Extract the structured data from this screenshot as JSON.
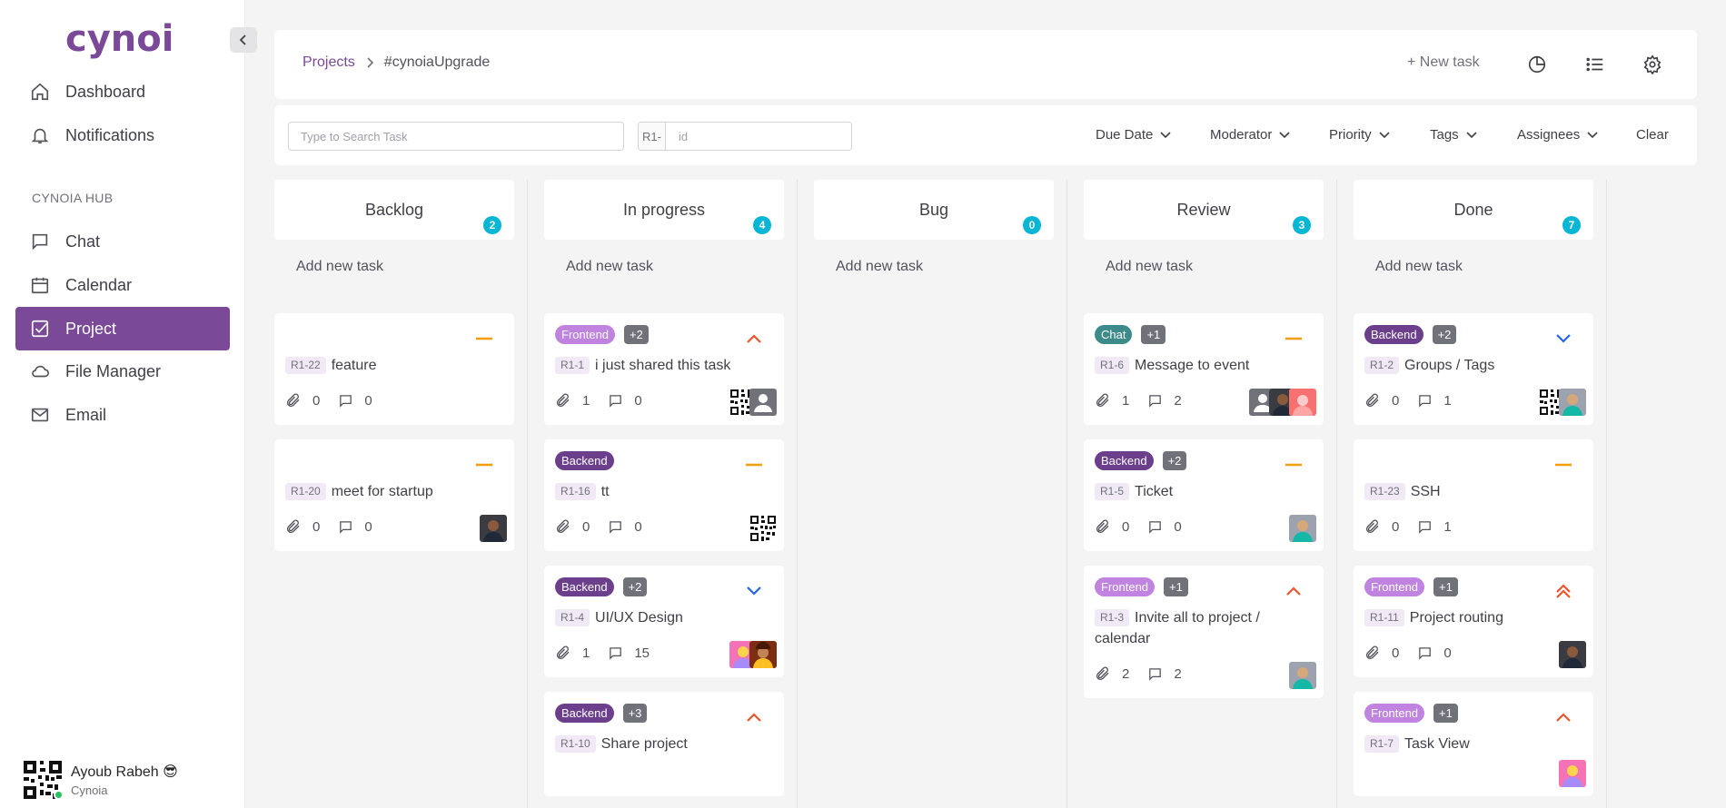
{
  "brand": {
    "name": "cynoia"
  },
  "sidebar": {
    "top_items": [
      {
        "label": "Dashboard",
        "icon": "home-icon"
      },
      {
        "label": "Notifications",
        "icon": "bell-icon"
      }
    ],
    "section_label": "CYNOIA HUB",
    "items": [
      {
        "label": "Chat",
        "icon": "chat-icon"
      },
      {
        "label": "Calendar",
        "icon": "calendar-icon"
      },
      {
        "label": "Project",
        "icon": "checkbox-icon",
        "active": true
      },
      {
        "label": "File Manager",
        "icon": "cloud-icon"
      },
      {
        "label": "Email",
        "icon": "mail-icon"
      }
    ],
    "user": {
      "name": "Ayoub Rabeh 😎",
      "org": "Cynoia",
      "status": "online"
    }
  },
  "header": {
    "breadcrumb": [
      "Projects",
      "#cynoiaUpgrade"
    ],
    "new_task_label": "+ New task"
  },
  "filters": {
    "search_placeholder": "Type to Search Task",
    "id_prefix": "R1-",
    "id_placeholder": "id",
    "dropdowns": [
      "Due Date",
      "Moderator",
      "Priority",
      "Tags",
      "Assignees"
    ],
    "clear_label": "Clear"
  },
  "board": {
    "add_task_label": "Add new task",
    "columns": [
      {
        "name": "Backlog",
        "count": "2",
        "cards": [
          {
            "tags": [],
            "priority": "medium",
            "id": "R1-22",
            "title": "feature",
            "attachments": "0",
            "comments": "0",
            "avatars": []
          },
          {
            "tags": [],
            "priority": "medium",
            "id": "R1-20",
            "title": "meet for startup",
            "attachments": "0",
            "comments": "0",
            "avatars": [
              "photo-a"
            ]
          }
        ]
      },
      {
        "name": "In progress",
        "count": "4",
        "cards": [
          {
            "tags": [
              "Frontend",
              "+2"
            ],
            "priority": "high",
            "id": "R1-1",
            "title": "i just shared this task",
            "attachments": "1",
            "comments": "0",
            "avatars": [
              "qr",
              "user"
            ]
          },
          {
            "tags": [
              "Backend"
            ],
            "priority": "medium",
            "id": "R1-16",
            "title": "tt",
            "attachments": "0",
            "comments": "0",
            "avatars": [
              "qr"
            ]
          },
          {
            "tags": [
              "Backend",
              "+2"
            ],
            "priority": "low",
            "id": "R1-4",
            "title": "UI/UX Design",
            "attachments": "1",
            "comments": "15",
            "avatars": [
              "photo-d",
              "photo-e"
            ]
          },
          {
            "tags": [
              "Backend",
              "+3"
            ],
            "priority": "high",
            "id": "R1-10",
            "title": "Share project",
            "attachments": "",
            "comments": "",
            "avatars": []
          }
        ]
      },
      {
        "name": "Bug",
        "count": "0",
        "cards": []
      },
      {
        "name": "Review",
        "count": "3",
        "cards": [
          {
            "tags": [
              "Chat",
              "+1"
            ],
            "priority": "medium",
            "id": "R1-6",
            "title": "Message to event",
            "attachments": "1",
            "comments": "2",
            "avatars": [
              "user",
              "photo-a",
              "photo-c"
            ]
          },
          {
            "tags": [
              "Backend",
              "+2"
            ],
            "priority": "medium",
            "id": "R1-5",
            "title": "Ticket",
            "attachments": "0",
            "comments": "0",
            "avatars": [
              "photo-b"
            ]
          },
          {
            "tags": [
              "Frontend",
              "+1"
            ],
            "priority": "high",
            "id": "R1-3",
            "title": "Invite all to project / calendar",
            "attachments": "2",
            "comments": "2",
            "avatars": [
              "photo-b"
            ]
          }
        ]
      },
      {
        "name": "Done",
        "count": "7",
        "cards": [
          {
            "tags": [
              "Backend",
              "+2"
            ],
            "priority": "low",
            "id": "R1-2",
            "title": "Groups / Tags",
            "attachments": "0",
            "comments": "1",
            "avatars": [
              "qr",
              "photo-b"
            ]
          },
          {
            "tags": [],
            "priority": "medium",
            "id": "R1-23",
            "title": "SSH",
            "attachments": "0",
            "comments": "1",
            "avatars": []
          },
          {
            "tags": [
              "Frontend",
              "+1"
            ],
            "priority": "highest",
            "id": "R1-11",
            "title": "Project routing",
            "attachments": "0",
            "comments": "0",
            "avatars": [
              "photo-a"
            ]
          },
          {
            "tags": [
              "Frontend",
              "+1"
            ],
            "priority": "high",
            "id": "R1-7",
            "title": "Task View",
            "attachments": "",
            "comments": "",
            "avatars": [
              "photo-d"
            ]
          }
        ]
      }
    ]
  },
  "colors": {
    "accent": "#7a4a99",
    "badge": "#06b6d4",
    "priority_medium": "#f59e0b",
    "priority_high": "#f0542d",
    "priority_low": "#2563eb"
  }
}
